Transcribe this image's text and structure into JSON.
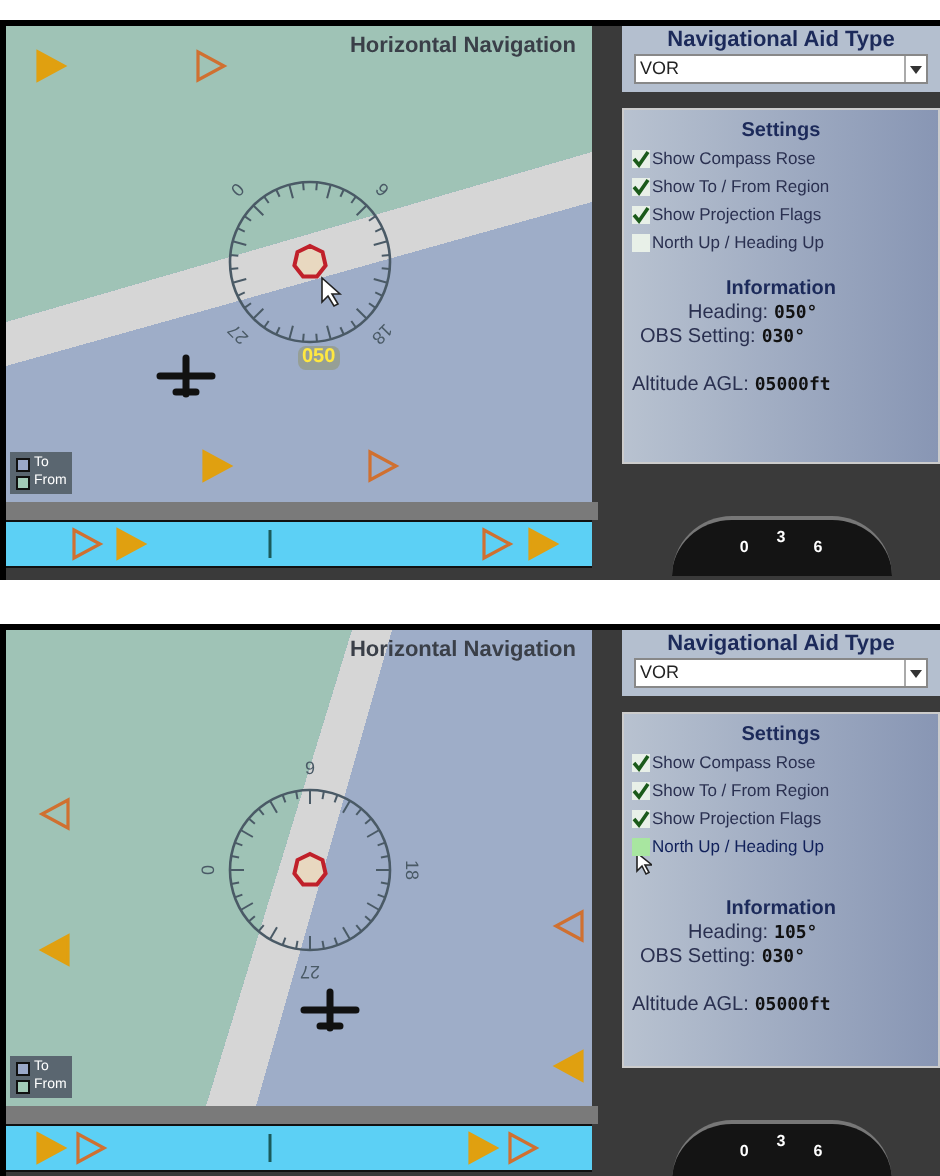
{
  "panels": [
    {
      "title": "Horizontal Navigation",
      "compass_labels": [
        "0",
        "9",
        "18",
        "27"
      ],
      "heading_badge": "050",
      "legend": [
        {
          "label": "To",
          "color": "#9aa8c8"
        },
        {
          "label": "From",
          "color": "#a3cbb8"
        }
      ],
      "nav_aid": {
        "label": "Navigational Aid Type",
        "value": "VOR"
      },
      "settings": {
        "title": "Settings",
        "options": [
          {
            "label": "Show Compass Rose",
            "checked": true,
            "hovered": false
          },
          {
            "label": "Show To / From Region",
            "checked": true,
            "hovered": false
          },
          {
            "label": "Show Projection Flags",
            "checked": true,
            "hovered": false
          },
          {
            "label": "North Up / Heading Up",
            "checked": false,
            "hovered": false
          }
        ]
      },
      "information": {
        "title": "Information",
        "heading_label": "Heading:",
        "heading_value": "050°",
        "obs_label": "OBS Setting:",
        "obs_value": "030°",
        "altitude_label": "Altitude AGL:",
        "altitude_value": "05000ft"
      },
      "dial_labels": [
        "0",
        "3",
        "6"
      ]
    },
    {
      "title": "Horizontal Navigation",
      "compass_labels": [
        "0",
        "9",
        "18",
        "27"
      ],
      "legend": [
        {
          "label": "To",
          "color": "#9aa8c8"
        },
        {
          "label": "From",
          "color": "#a3cbb8"
        }
      ],
      "nav_aid": {
        "label": "Navigational Aid Type",
        "value": "VOR"
      },
      "settings": {
        "title": "Settings",
        "options": [
          {
            "label": "Show Compass Rose",
            "checked": true,
            "hovered": false
          },
          {
            "label": "Show To / From Region",
            "checked": true,
            "hovered": false
          },
          {
            "label": "Show Projection Flags",
            "checked": true,
            "hovered": false
          },
          {
            "label": "North Up / Heading Up",
            "checked": false,
            "hovered": true
          }
        ]
      },
      "information": {
        "title": "Information",
        "heading_label": "Heading:",
        "heading_value": "105°",
        "obs_label": "OBS Setting:",
        "obs_value": "030°",
        "altitude_label": "Altitude AGL:",
        "altitude_value": "05000ft"
      },
      "dial_labels": [
        "0",
        "3",
        "6"
      ]
    }
  ]
}
